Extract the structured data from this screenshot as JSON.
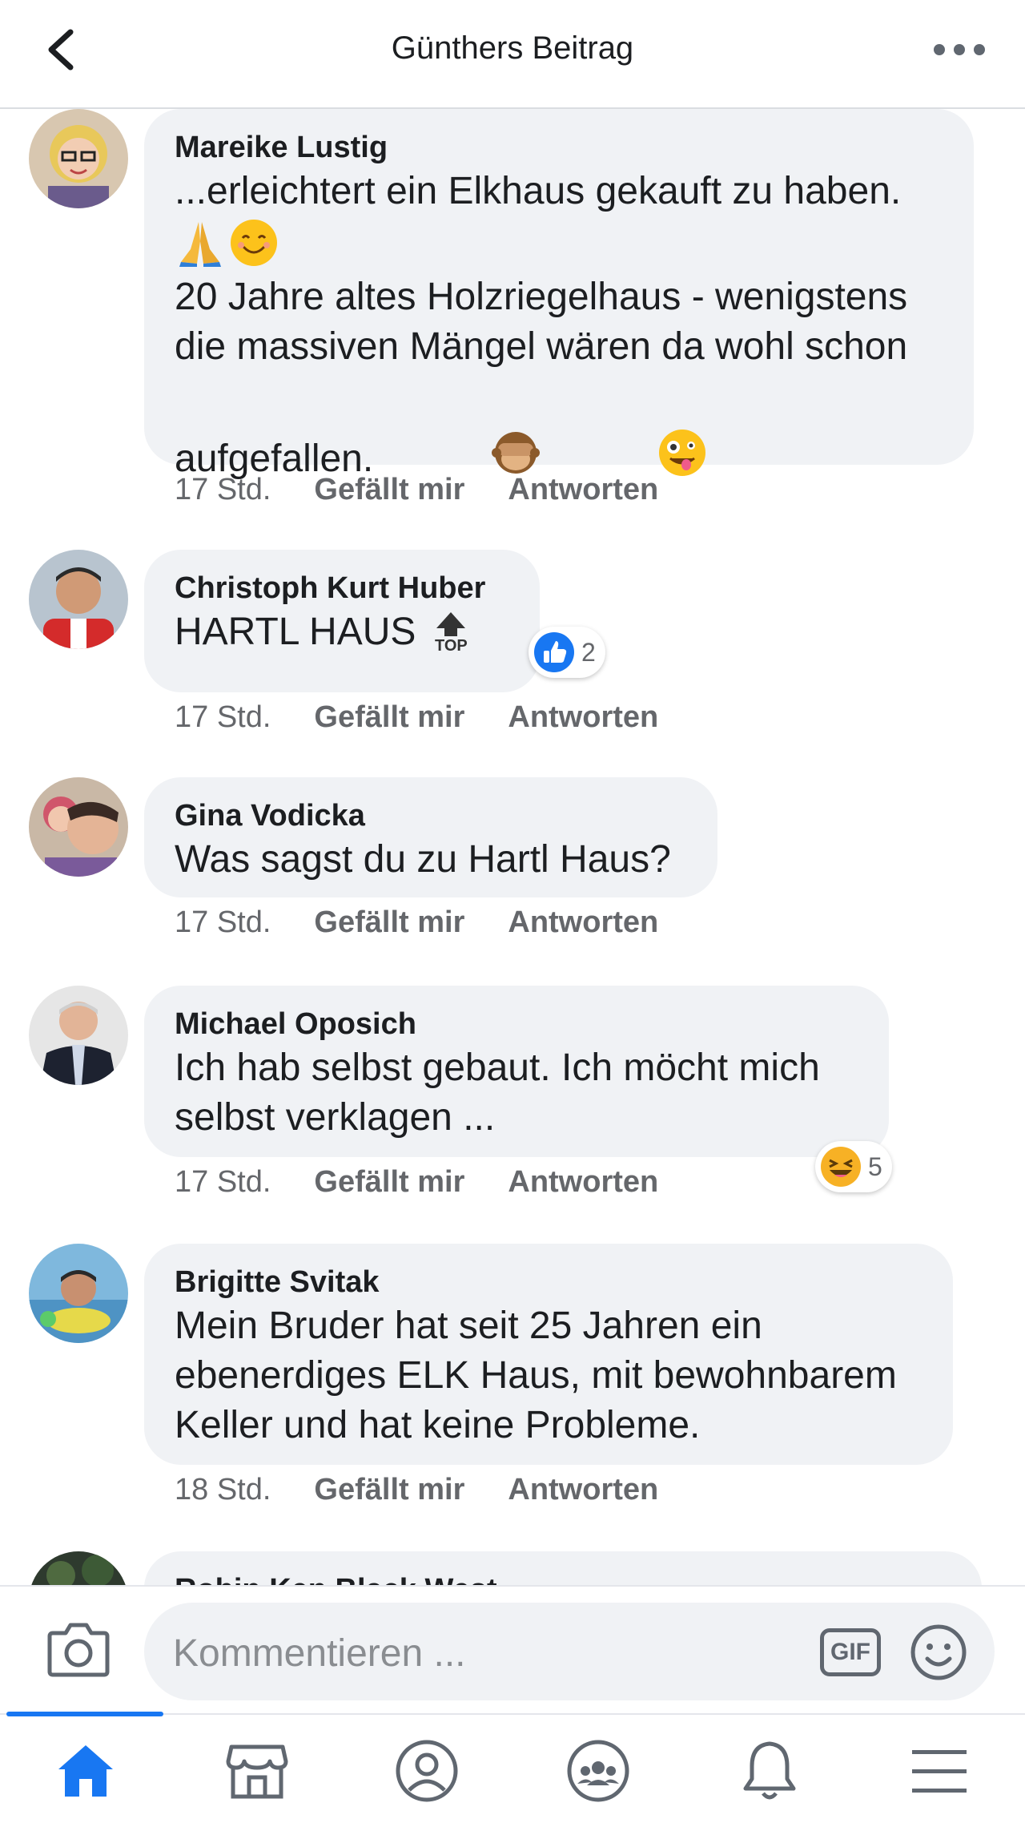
{
  "header": {
    "title": "Günthers Beitrag"
  },
  "comments": [
    {
      "author": "Mareike Lustig",
      "line1": "...erleichtert ein Elkhaus gekauft zu haben.",
      "line2": "20 Jahre altes Holzriegelhaus - wenigstens\ndie massiven Mängel wären da wohl schon",
      "line3": "aufgefallen.",
      "time": "17 Std.",
      "like": "Gefällt mir",
      "reply": "Antworten"
    },
    {
      "author": "Christoph Kurt Huber",
      "text": "HARTL HAUS",
      "top_label": "TOP",
      "time": "17 Std.",
      "like": "Gefällt mir",
      "reply": "Antworten",
      "reaction_count": "2"
    },
    {
      "author": "Gina Vodicka",
      "text": "Was sagst du zu Hartl Haus?",
      "time": "17 Std.",
      "like": "Gefällt mir",
      "reply": "Antworten"
    },
    {
      "author": "Michael Oposich",
      "text": "Ich hab selbst gebaut. Ich möcht mich\nselbst verklagen ...",
      "time": "17 Std.",
      "like": "Gefällt mir",
      "reply": "Antworten",
      "reaction_count": "5"
    },
    {
      "author": "Brigitte Svitak",
      "text": "Mein Bruder hat seit 25 Jahren ein\nebenerdiges ELK Haus, mit bewohnbarem\nKeller und hat keine Probleme.",
      "time": "18 Std.",
      "like": "Gefällt mir",
      "reply": "Antworten"
    },
    {
      "author": "Robin Ken Black West"
    }
  ],
  "composer": {
    "placeholder": "Kommentieren ...",
    "gif_label": "GIF"
  },
  "tabbar": {
    "items": [
      "home-icon",
      "marketplace-icon",
      "profile-icon",
      "groups-icon",
      "notifications-icon",
      "menu-icon"
    ],
    "active": "home-icon"
  },
  "colors": {
    "accent": "#1877f2",
    "bubble": "#f0f2f5",
    "muted_text": "#65676b"
  }
}
